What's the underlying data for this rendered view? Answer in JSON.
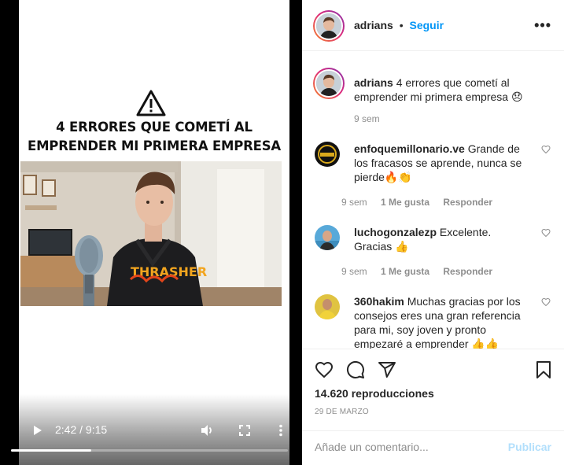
{
  "video": {
    "title_line1": "4 ERRORES QUE COMETÍ AL",
    "title_line2": "EMPRENDER MI PRIMERA EMPRESA",
    "hoodie_text": "THRASHER",
    "current_time": "2:42",
    "duration": "9:15",
    "time_display": "2:42 / 9:15",
    "progress_fraction": 0.29,
    "icons": [
      "play-icon",
      "volume-icon",
      "fullscreen-icon",
      "more-vertical-icon",
      "warning-icon"
    ]
  },
  "header": {
    "username": "adrians",
    "separator": "•",
    "follow_label": "Seguir",
    "more_icon": "more-horizontal-icon"
  },
  "caption": {
    "username": "adrians",
    "text": "4 errores que cometí al emprender mi primera empresa",
    "emoji": "😞",
    "time": "9 sem"
  },
  "comments": [
    {
      "username": "enfoquemillonario.ve",
      "text": "Grande de los fracasos se aprende, nunca se pierde",
      "emoji": "🔥👏",
      "time": "9 sem",
      "likes": "1 Me gusta",
      "reply_label": "Responder"
    },
    {
      "username": "luchogonzalezp",
      "text": "Excelente. Gracias",
      "emoji": "👍",
      "time": "9 sem",
      "likes": "1 Me gusta",
      "reply_label": "Responder"
    },
    {
      "username": "360hakim",
      "text": "Muchas gracias por los consejos eres una gran referencia para mi, soy joven y pronto empezaré a emprender",
      "emoji": "👍👍",
      "time": "",
      "likes": "",
      "reply_label": ""
    }
  ],
  "actions": {
    "views": "14.620 reproducciones",
    "date": "29 DE MARZO",
    "icons": [
      "heart-icon",
      "comment-icon",
      "share-icon",
      "bookmark-icon"
    ]
  },
  "add_comment": {
    "placeholder": "Añade un comentario...",
    "publish_label": "Publicar"
  },
  "colors": {
    "accent": "#0095f6",
    "publish_disabled": "#b2dffc",
    "meta_gray": "#8e8e8e",
    "text": "#262626"
  }
}
